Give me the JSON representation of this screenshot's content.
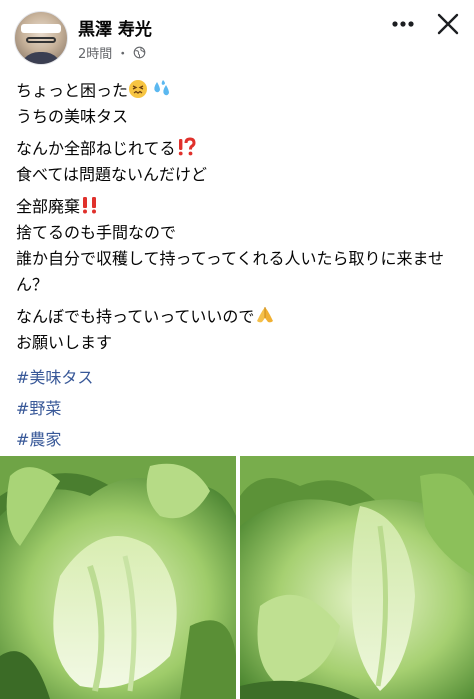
{
  "post": {
    "author": "黒澤 寿光",
    "time": "2時間",
    "separator": "・",
    "privacy_icon": "globe-icon"
  },
  "toolbar": {
    "more_icon": "more-options-icon",
    "close_icon": "close-icon"
  },
  "content": {
    "p1_line1": "ちょっと困った",
    "p1_line2": "うちの美味タス",
    "p2_line1": "なんか全部ねじれてる",
    "p2_line2": "食べては問題ないんだけど",
    "p3_line1": "全部廃棄",
    "p3_line2": "捨てるのも手間なので",
    "p3_line3": "誰か自分で収穫して持ってってくれる人いたら取りに来ませ​ん？",
    "p4_line1": "なんぼでも持っていっていいので",
    "p4_line2": "お願いします",
    "hashtags": [
      "#美味タス",
      "#野菜",
      "#農家"
    ]
  },
  "emojis": {
    "confounded": "confounded-face-icon",
    "sweat": "sweat-droplets-icon",
    "exclaim_question": "exclamation-question-icon",
    "double_exclaim": "double-exclamation-icon",
    "pray": "folded-hands-icon"
  },
  "colors": {
    "hashtag": "#385898",
    "meta": "#65676b",
    "lettuce_light": "#c9e6a0",
    "lettuce_dark": "#5e9a3a"
  }
}
